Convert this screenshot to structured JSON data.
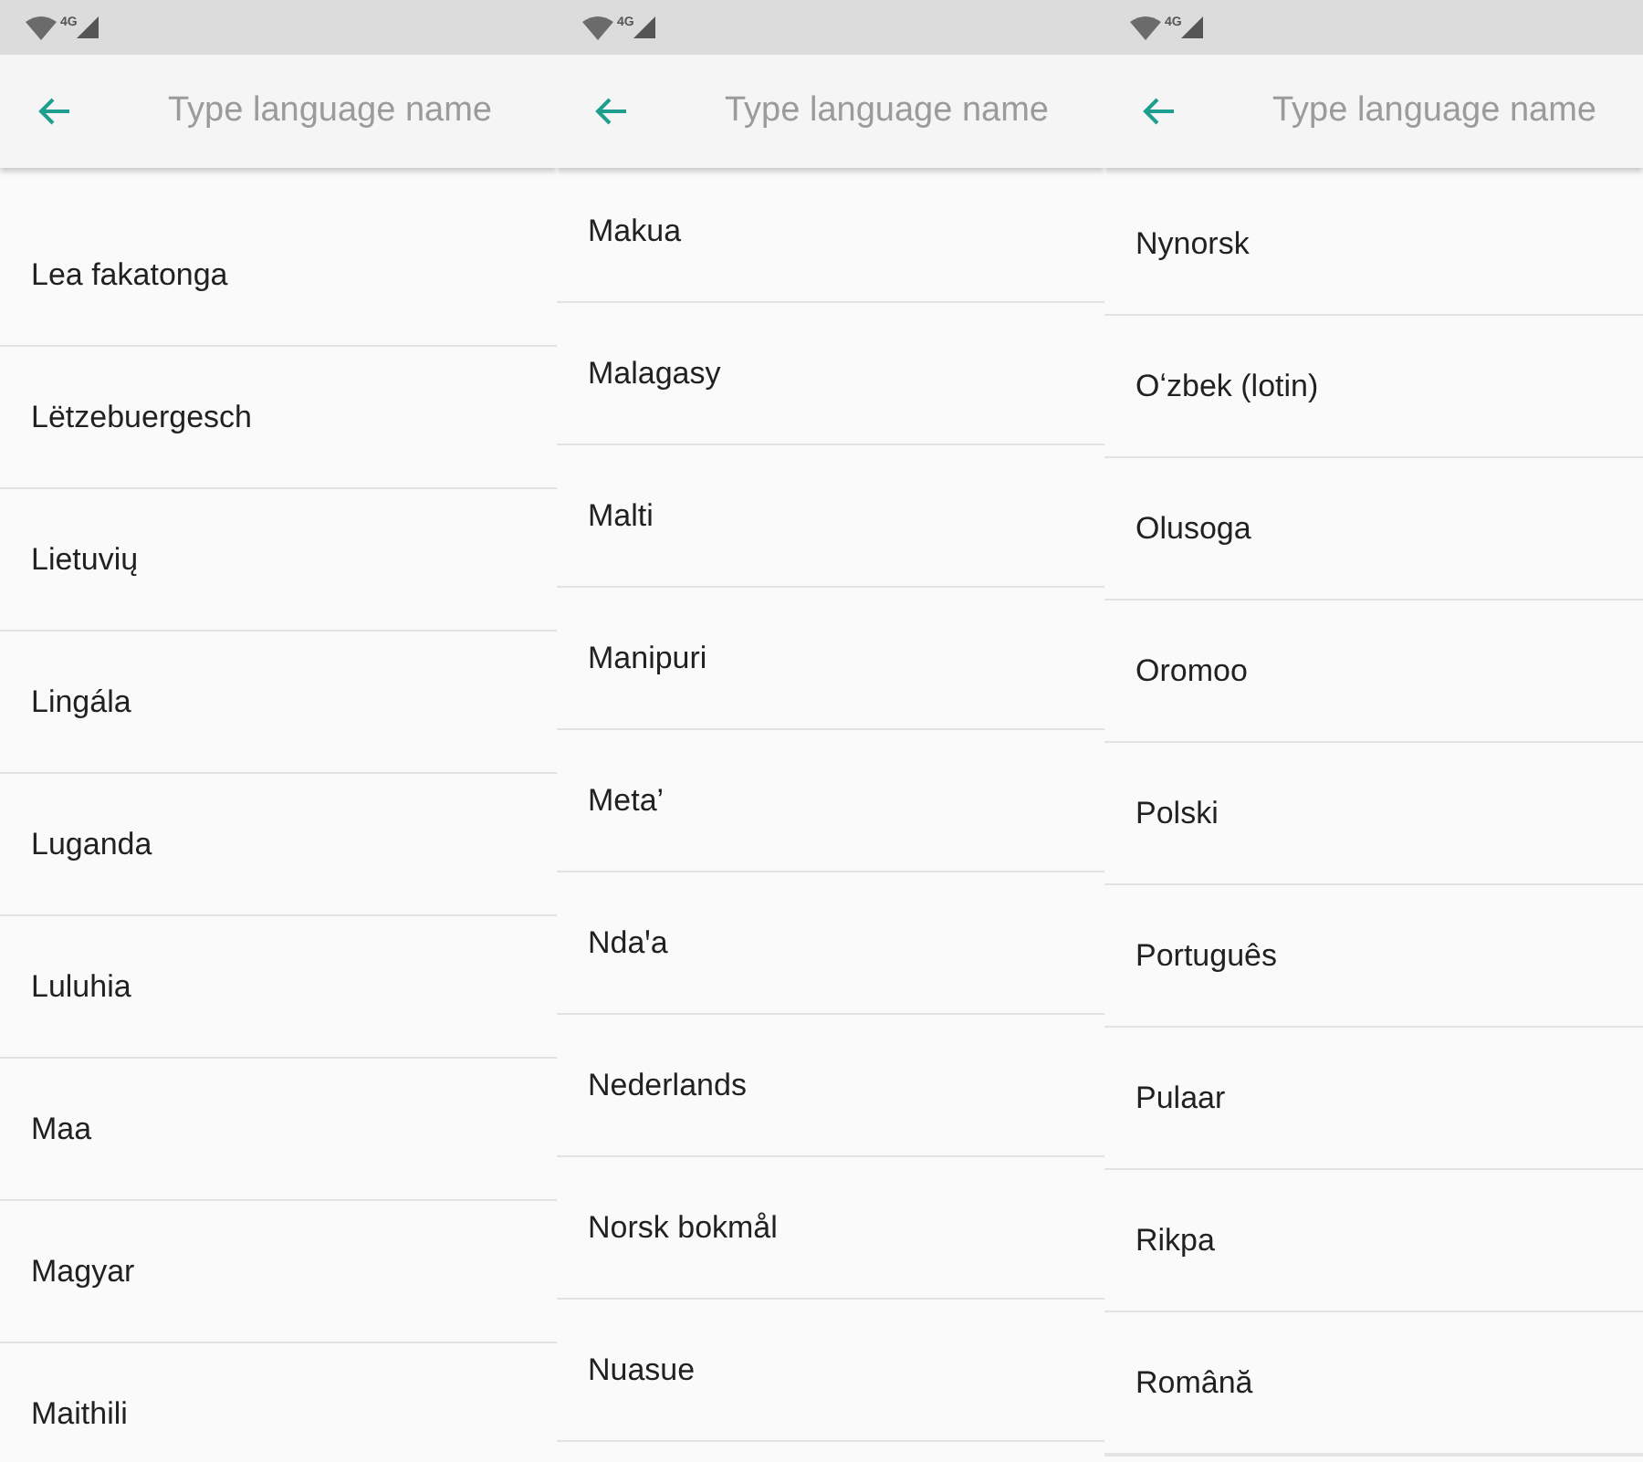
{
  "screens": [
    {
      "status_bar": {
        "network": "4G"
      },
      "search": {
        "placeholder": "Type language name"
      },
      "languages": [
        "Lea fakatonga",
        "Lëtzebuergesch",
        "Lietuvių",
        "Lingála",
        "Luganda",
        "Luluhia",
        "Maa",
        "Magyar",
        "Maithili"
      ]
    },
    {
      "status_bar": {
        "network": "4G"
      },
      "search": {
        "placeholder": "Type language name"
      },
      "languages": [
        "Makua",
        "Malagasy",
        "Malti",
        "Manipuri",
        "Meta’",
        "Ndaꞌa",
        "Nederlands",
        "Norsk bokmål",
        "Nuasue"
      ]
    },
    {
      "status_bar": {
        "network": "4G"
      },
      "search": {
        "placeholder": "Type language name"
      },
      "languages": [
        "Nynorsk",
        "Oʻzbek (lotin)",
        "Olusoga",
        "Oromoo",
        "Polski",
        "Português",
        "Pulaar",
        "Rikpa",
        "Română"
      ]
    }
  ]
}
